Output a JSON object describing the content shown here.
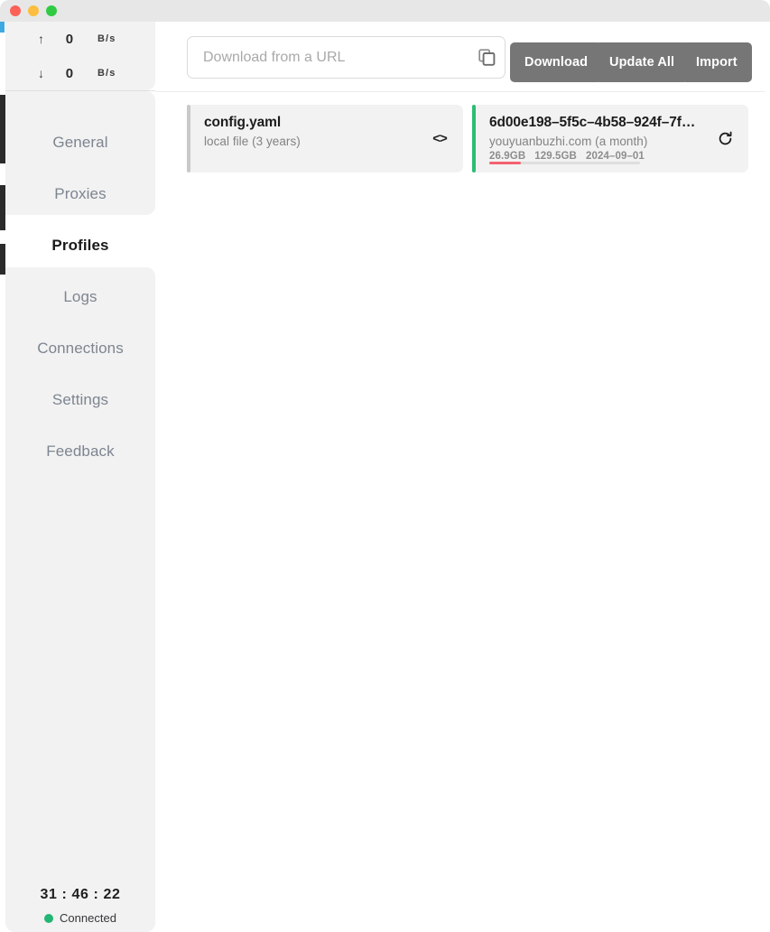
{
  "window": {
    "traffic_lights": [
      "close",
      "minimize",
      "zoom"
    ]
  },
  "sidebar": {
    "speed": {
      "upload": {
        "arrow": "↑",
        "value": "0",
        "unit": "B/s",
        "icon": "arrow-up-icon"
      },
      "download": {
        "arrow": "↓",
        "value": "0",
        "unit": "B/s",
        "icon": "arrow-down-icon"
      }
    },
    "items": [
      {
        "label": "General",
        "selected": false
      },
      {
        "label": "Proxies",
        "selected": false
      },
      {
        "label": "Profiles",
        "selected": true
      },
      {
        "label": "Logs",
        "selected": false
      },
      {
        "label": "Connections",
        "selected": false
      },
      {
        "label": "Settings",
        "selected": false
      },
      {
        "label": "Feedback",
        "selected": false
      }
    ],
    "footer": {
      "uptime": "31 : 46 : 22",
      "status_label": "Connected",
      "status_color": "#22b573"
    }
  },
  "toolbar": {
    "url_input": {
      "value": "",
      "placeholder": "Download from a URL"
    },
    "paste_icon": "copy-icon",
    "buttons": [
      {
        "label": "Download"
      },
      {
        "label": "Update All"
      },
      {
        "label": "Import"
      }
    ]
  },
  "profiles": [
    {
      "title": "config.yaml",
      "subtitle": "local file (3 years)",
      "accent_color": "#c9c9c9",
      "active": false,
      "action_icon": "code-brackets-icon",
      "usage": null
    },
    {
      "title": "6d00e198–5f5c–4b58–924f–7f…",
      "subtitle": "youyuanbuzhi.com (a month)",
      "accent_color": "#2dbd72",
      "active": true,
      "action_icon": "refresh-icon",
      "usage": {
        "used": "26.9GB",
        "total": "129.5GB",
        "expire": "2024–09–01",
        "percent": 20.8,
        "bar_color": "#f4616e"
      }
    }
  ]
}
